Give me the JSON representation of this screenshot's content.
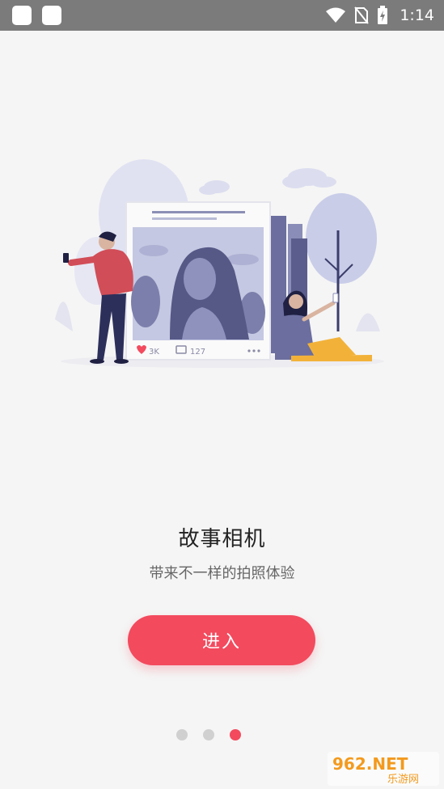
{
  "status_bar": {
    "time": "1:14",
    "icons": [
      "app-notification-icon",
      "app-notification-icon",
      "wifi-icon",
      "no-sim-icon",
      "battery-charging-icon"
    ]
  },
  "onboarding": {
    "title": "故事相机",
    "subtitle": "带来不一样的拍照体验",
    "enter_button_label": "进入",
    "page_indicator": {
      "total": 3,
      "current": 3
    },
    "illustration": {
      "likes": "3K",
      "comments": "127"
    }
  },
  "watermark": {
    "brand": "962.NET",
    "text": "乐游网"
  },
  "colors": {
    "accent": "#f34a5e",
    "status_bar": "#7b7b7b",
    "background": "#f5f5f5",
    "dot_inactive": "#d0d0d0",
    "illustration_purple": "#6b6e9e"
  }
}
